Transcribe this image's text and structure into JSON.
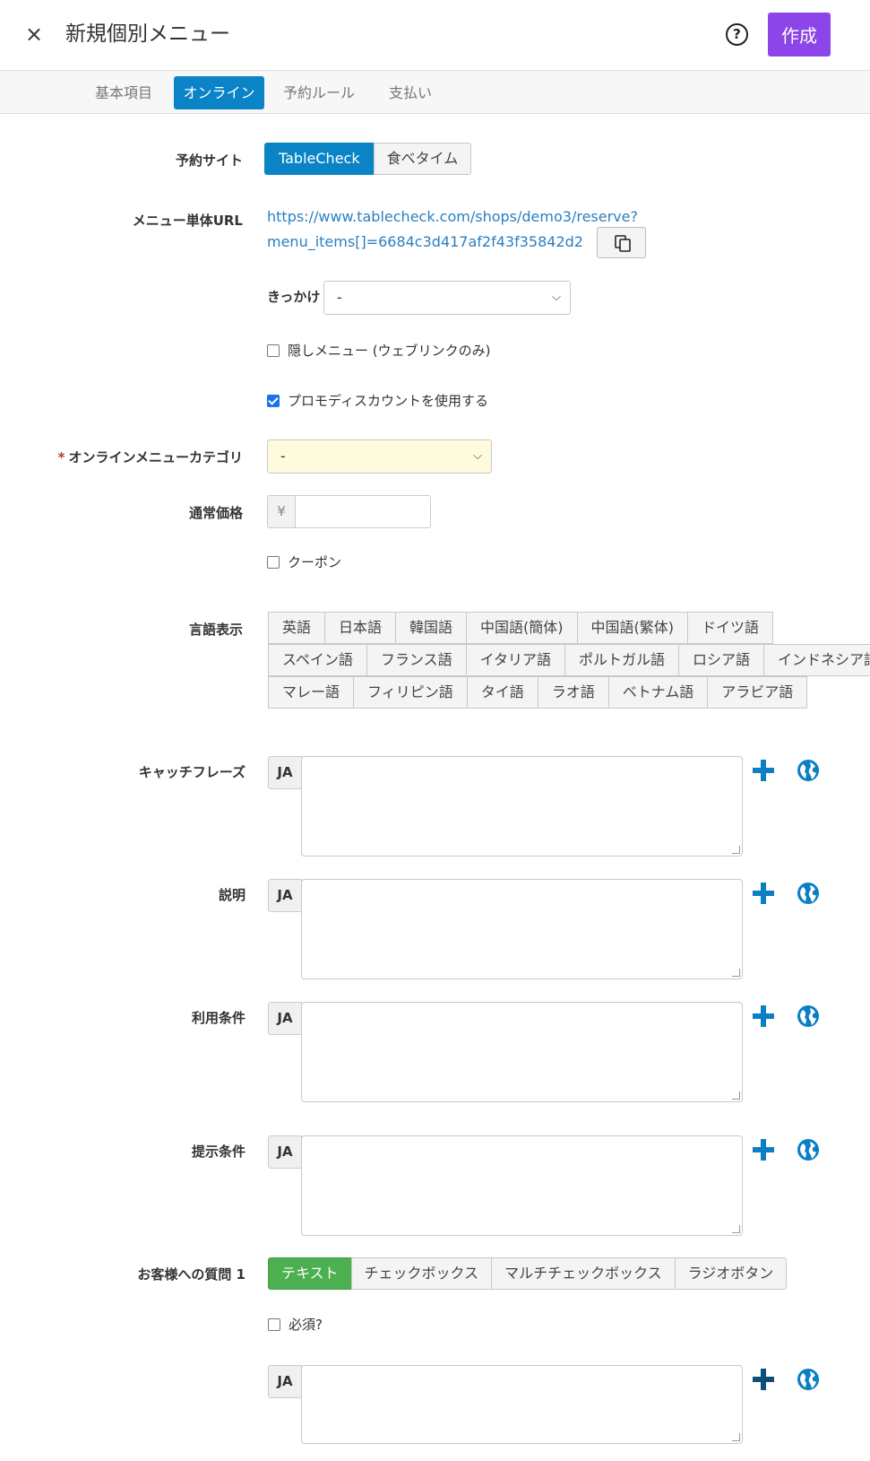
{
  "header": {
    "close_glyph": "×",
    "title": "新規個別メニュー",
    "help_glyph": "?",
    "create_label": "作成"
  },
  "tabs": [
    "基本項目",
    "オンライン",
    "予約ルール",
    "支払い"
  ],
  "reservation_site": {
    "label": "予約サイト",
    "options": [
      "TableCheck",
      "食べタイム"
    ]
  },
  "menu_url": {
    "label": "メニュー単体URL",
    "line1": "https://www.tablecheck.com/shops/demo3/reserve?",
    "line2": "menu_items[]=6684c3d417af2f43f35842d2"
  },
  "trigger": {
    "label": "きっかけ",
    "value": "-"
  },
  "hidden_menu": {
    "label": "隠しメニュー (ウェブリンクのみ)",
    "checked": false
  },
  "promo_discount": {
    "label": "プロモディスカウントを使用する",
    "checked": true
  },
  "online_category": {
    "required_mark": "*",
    "label": "オンラインメニューカテゴリ",
    "value": "-"
  },
  "regular_price": {
    "label": "通常価格",
    "currency": "¥",
    "value": ""
  },
  "coupon": {
    "label": "クーポン",
    "checked": false
  },
  "language_display": {
    "label": "言語表示",
    "rows": [
      [
        "英語",
        "日本語",
        "韓国語",
        "中国語(簡体)",
        "中国語(繁体)",
        "ドイツ語"
      ],
      [
        "スペイン語",
        "フランス語",
        "イタリア語",
        "ポルトガル語",
        "ロシア語",
        "インドネシア語"
      ],
      [
        "マレー語",
        "フィリピン語",
        "タイ語",
        "ラオ語",
        "ベトナム語",
        "アラビア語"
      ]
    ]
  },
  "text_fields": [
    {
      "label": "キャッチフレーズ",
      "lang": "JA"
    },
    {
      "label": "説明",
      "lang": "JA"
    },
    {
      "label": "利用条件",
      "lang": "JA"
    },
    {
      "label": "提示条件",
      "lang": "JA"
    }
  ],
  "question": {
    "label": "お客様への質問 1",
    "types": [
      "テキスト",
      "チェックボックス",
      "マルチチェックボックス",
      "ラジオボタン"
    ],
    "required_label": "必須?",
    "lang": "JA"
  },
  "colors": {
    "primary": "#0a84c6",
    "create": "#8b45e8",
    "link": "#2a7fc1",
    "green": "#4caf50"
  },
  "icons": [
    "close-icon",
    "help-icon",
    "copy-icon",
    "chevron-down-icon",
    "plus-icon",
    "globe-icon"
  ]
}
